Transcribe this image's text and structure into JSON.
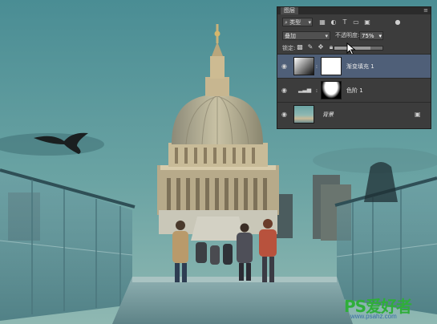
{
  "watermark": {
    "logo_text": "PS爱好者",
    "url": "www.psahz.com"
  },
  "panel": {
    "tab_label": "图层",
    "menu_icon": "panel-menu-icon",
    "filter": {
      "kind_label": "类型"
    },
    "blend_mode": "叠加",
    "opacity_label": "不透明度:",
    "opacity_value": "75%",
    "lock_label": "锁定:",
    "fill_level": 0.75,
    "layers": [
      {
        "name": "渐变填充 1",
        "selected": true,
        "kind": "gradient-fill"
      },
      {
        "name": "色阶 1",
        "selected": false,
        "kind": "levels-adjustment"
      },
      {
        "name": "背景",
        "selected": false,
        "kind": "background",
        "locked": true
      }
    ]
  },
  "colors": {
    "panel_bg": "#3c3c3c",
    "selected_layer": "#4f5f78",
    "sky": "#4f8f94",
    "watermark_green": "#2fae3a"
  }
}
